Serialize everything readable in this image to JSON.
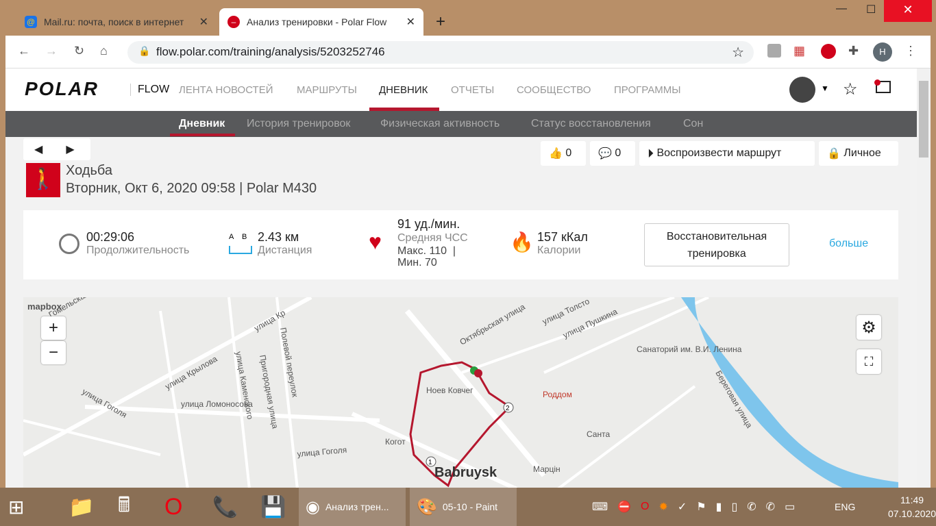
{
  "tabs": [
    {
      "title": "Mail.ru: почта, поиск в интернет",
      "icon": "@"
    },
    {
      "title": "Анализ тренировки - Polar Flow"
    }
  ],
  "url": "flow.polar.com/training/analysis/5203252746",
  "profile_initial": "Н",
  "header": {
    "logo": "POLAR",
    "flow": "FLOW",
    "nav": [
      "ЛЕНТА НОВОСТЕЙ",
      "МАРШРУТЫ",
      "ДНЕВНИК",
      "ОТЧЕТЫ",
      "СООБЩЕСТВО",
      "ПРОГРАММЫ"
    ],
    "active": "ДНЕВНИК"
  },
  "subnav": [
    "Дневник",
    "История тренировок",
    "Физическая активность",
    "Статус восстановления",
    "Сон"
  ],
  "actions": {
    "likes": "0",
    "comments": "0",
    "replay": "Воспроизвести маршрут",
    "privacy": "Личное"
  },
  "training": {
    "sport": "Ходьба",
    "date": "Вторник, Окт 6, 2020 09:58 | Polar M430"
  },
  "summary": {
    "duration": "00:29:06",
    "duration_label": "Продолжительность",
    "ab": "A    B",
    "distance": "2.43 км",
    "distance_label": "Дистанция",
    "hr": "91 уд./мин.",
    "hr_label": "Средняя ЧСС",
    "hr_max": "Макс. 110  |",
    "hr_min": "Мин. 70",
    "calories": "157 кКал",
    "calories_label": "Калории",
    "benefit": "Восстановительная тренировка",
    "more": "больше"
  },
  "map": {
    "attribution": "mapbox",
    "labels": [
      "Гомельская",
      "улица Кр",
      "улица Крылова",
      "улица Ломоносова",
      "улица Гоголя",
      "улица Гоголя",
      "улица Каменского",
      "Пригородная улица",
      "Полевой переулок",
      "Октябрьская улица",
      "улица Толсто",
      "улица Пушкина",
      "Санаторий им. В.И. Ленина",
      "Береговая улица",
      "Ноев Ковчег",
      "Роддом",
      "Когот",
      "Санта",
      "Марцін",
      "Babruysk"
    ],
    "markers": [
      "1",
      "2"
    ]
  },
  "taskbar": {
    "chrome": "Анализ трен...",
    "paint": "05-10 - Paint",
    "lang": "ENG",
    "time": "11:49",
    "date": "07.10.2020"
  }
}
